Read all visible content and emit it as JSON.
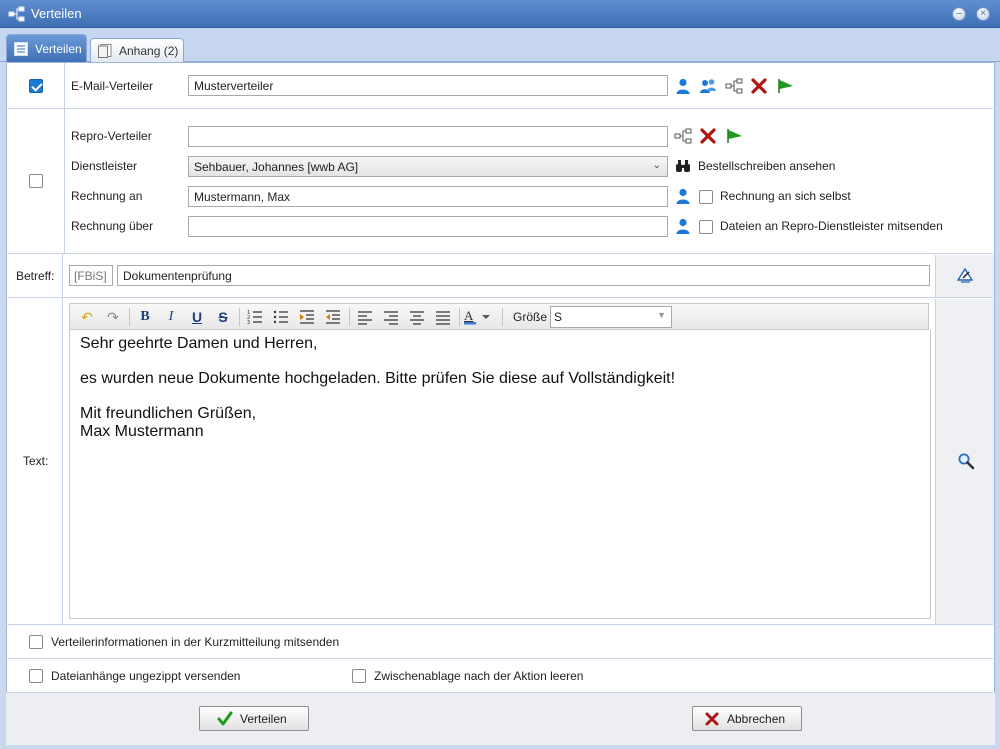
{
  "window": {
    "title": "Verteilen",
    "icon": "share-network-icon"
  },
  "tabs": [
    {
      "label": "Verteilen",
      "icon": "list-icon",
      "active": true
    },
    {
      "label": "Anhang (2)",
      "icon": "document-stack-icon",
      "active": false
    }
  ],
  "email": {
    "checked": true,
    "label": "E-Mail-Verteiler",
    "value": "Musterverteiler",
    "icons": [
      "user-icon",
      "users-icon",
      "network-icon",
      "delete-icon",
      "send-flag-icon"
    ]
  },
  "repro": {
    "checked": false,
    "verteiler_label": "Repro-Verteiler",
    "verteiler_value": "",
    "dienstleister_label": "Dienstleister",
    "dienstleister_value": "Sehbauer, Johannes [wwb AG]",
    "bestell_link": "Bestellschreiben ansehen",
    "rechnung_an_label": "Rechnung an",
    "rechnung_an_value": "Mustermann, Max",
    "rechnung_selbst_label": "Rechnung an sich selbst",
    "rechnung_ueber_label": "Rechnung über",
    "rechnung_ueber_value": "",
    "dateien_label": "Dateien an Repro-Dienstleister mitsenden"
  },
  "betreff": {
    "label": "Betreff:",
    "prefix": "[FBiS]",
    "value": "Dokumentenprüfung"
  },
  "text": {
    "label": "Text:",
    "groesse_label": "Größe",
    "groesse_value": "S",
    "greeting": "Sehr geehrte Damen und Herren,",
    "body": "es wurden neue Dokumente hochgeladen. Bitte prüfen Sie diese auf Vollständigkeit!",
    "closing": "Mit freundlichen Grüßen,",
    "signature": "Max Mustermann"
  },
  "options": {
    "kurzmitteilung": "Verteilerinformationen in der Kurzmitteilung mitsenden",
    "ungezippt": "Dateianhänge ungezippt versenden",
    "zwischenablage": "Zwischenablage nach der Aktion leeren"
  },
  "buttons": {
    "verteilen": "Verteilen",
    "abbrechen": "Abbrechen"
  },
  "colors": {
    "title_bar": "#4a7bc0",
    "accent_blue": "#1e78d6",
    "delete_red": "#b01515",
    "send_green": "#1e9a1e"
  }
}
